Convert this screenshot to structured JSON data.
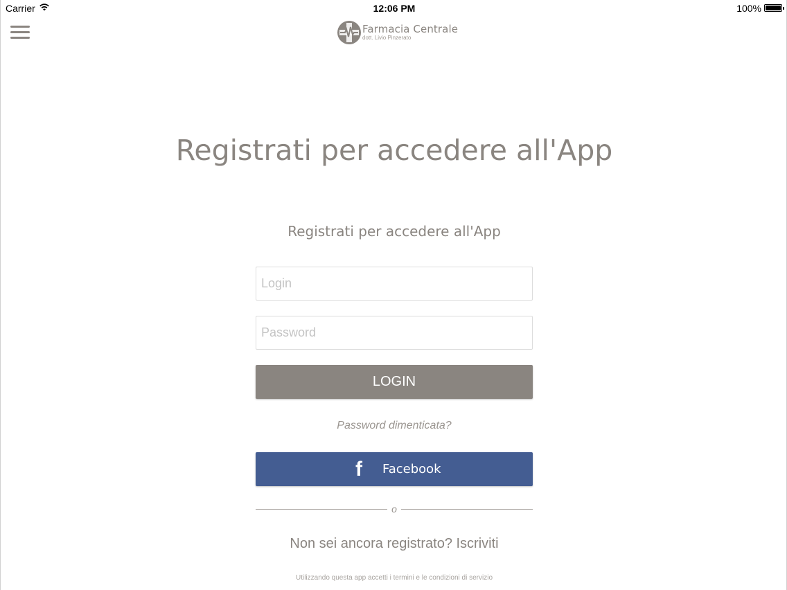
{
  "status_bar": {
    "carrier": "Carrier",
    "time": "12:06 PM",
    "battery": "100%"
  },
  "header": {
    "menu_icon": "hamburger-icon",
    "logo_name": "Farmacia Centrale",
    "logo_subtitle": "dott. Livio Pinzerato"
  },
  "main": {
    "title": "Registrati per accedere all'App",
    "subtitle": "Registrati per accedere all'App",
    "login_placeholder": "Login",
    "password_placeholder": "Password",
    "login_button": "LOGIN",
    "forgot_password": "Password dimenticata?",
    "facebook_button": "Facebook",
    "facebook_icon": "facebook-f-icon",
    "or_separator": "o",
    "register_link": "Non sei ancora registrato? Iscriviti",
    "terms": "Utilizzando questa app accetti i termini e le condizioni di servizio"
  },
  "colors": {
    "accent": "#8a8580",
    "facebook": "#445d92"
  }
}
